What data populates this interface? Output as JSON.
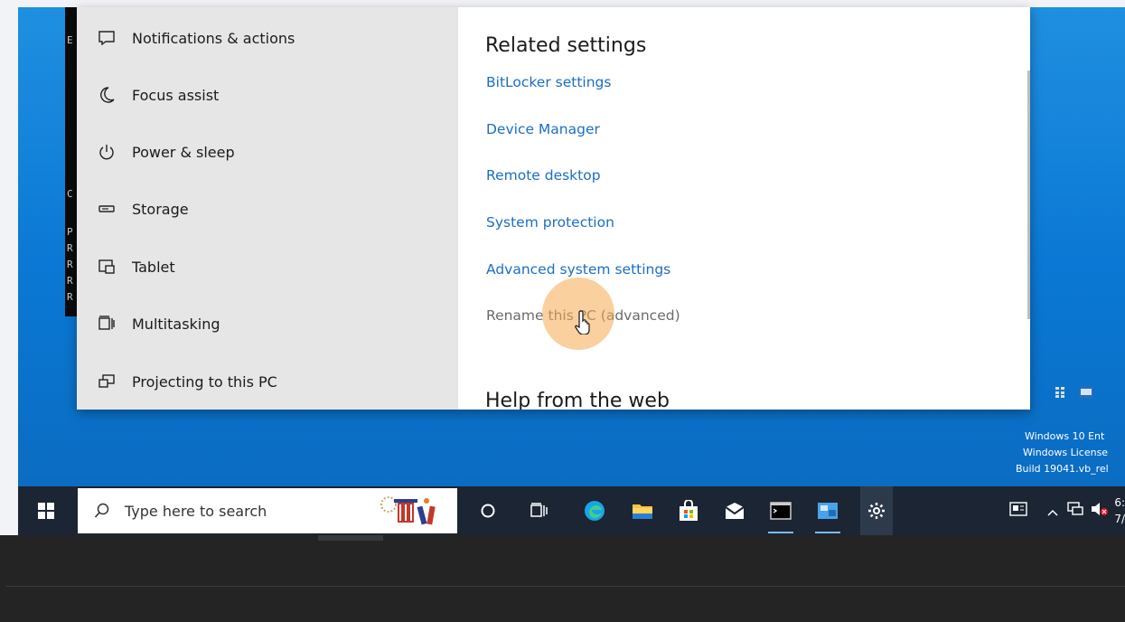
{
  "nav": {
    "items": [
      {
        "label": "Notifications & actions",
        "icon": "notifications-icon"
      },
      {
        "label": "Focus assist",
        "icon": "moon-icon"
      },
      {
        "label": "Power & sleep",
        "icon": "power-icon"
      },
      {
        "label": "Storage",
        "icon": "storage-icon"
      },
      {
        "label": "Tablet",
        "icon": "tablet-icon"
      },
      {
        "label": "Multitasking",
        "icon": "multitasking-icon"
      },
      {
        "label": "Projecting to this PC",
        "icon": "projecting-icon"
      }
    ]
  },
  "content": {
    "related_title": "Related settings",
    "links": [
      {
        "label": "BitLocker settings"
      },
      {
        "label": "Device Manager"
      },
      {
        "label": "Remote desktop"
      },
      {
        "label": "System protection"
      },
      {
        "label": "Advanced system settings"
      },
      {
        "label": "Rename this PC (advanced)"
      }
    ],
    "help_title": "Help from the web"
  },
  "taskbar": {
    "search_placeholder": "Type here to search",
    "clock_line1": "6:",
    "clock_line2": "7/"
  },
  "watermark": {
    "line1": "Windows 10 Ent",
    "line2": "Windows License",
    "line3": "Build 19041.vb_rel"
  },
  "console": {
    "chars": [
      "E",
      "C",
      "P",
      "R",
      "R",
      "R",
      "R"
    ]
  },
  "colors": {
    "link": "#1a6fc4",
    "desktop": "#0a78d4",
    "taskbar": "#1b2533",
    "cursor_highlight": "#f5aa50"
  }
}
